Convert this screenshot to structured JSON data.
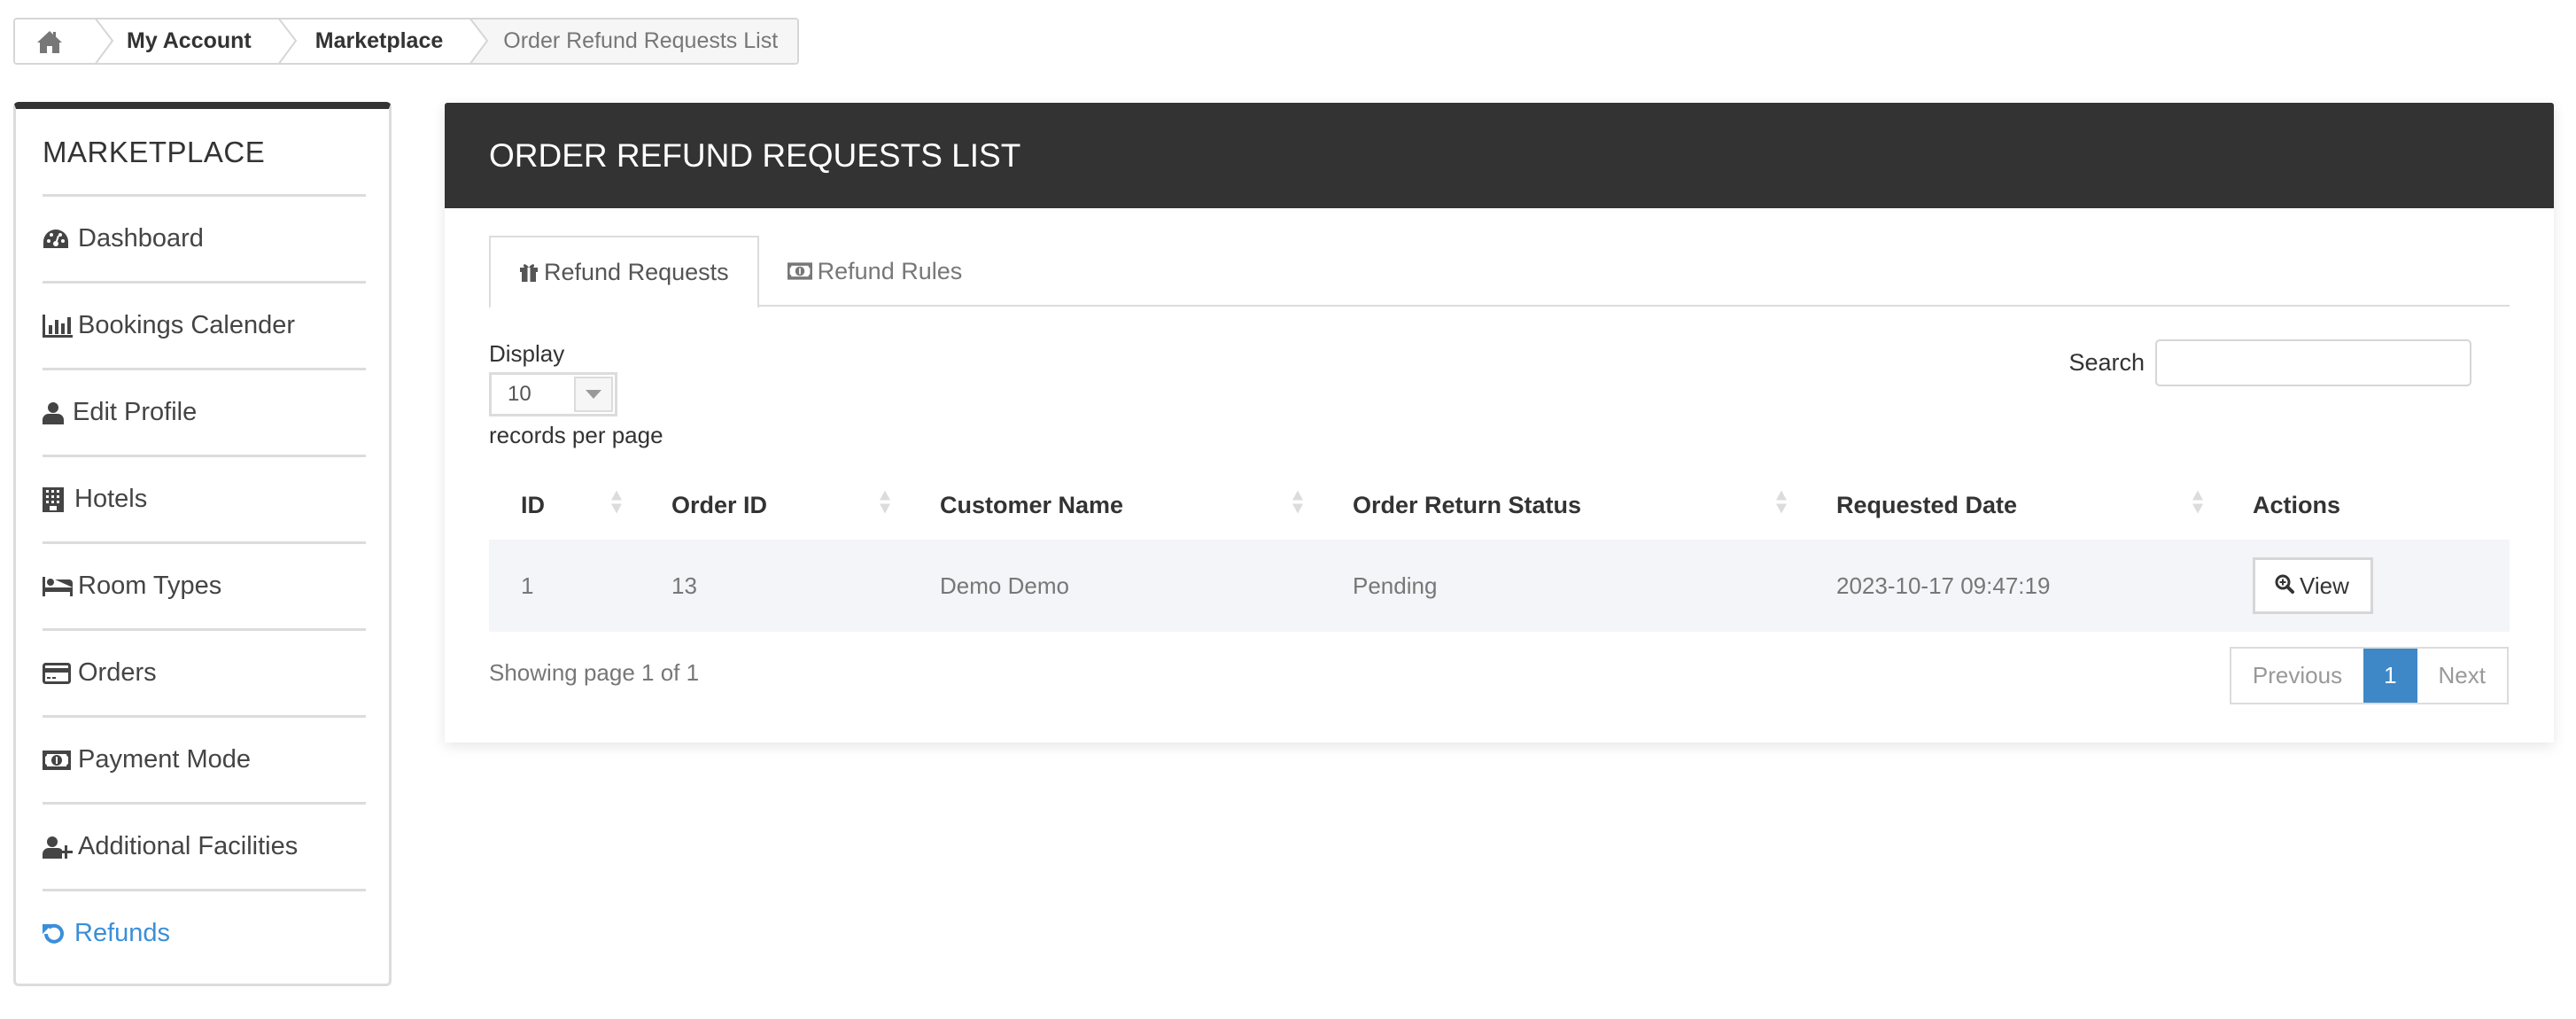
{
  "breadcrumb": {
    "home_icon": "home-icon",
    "items": [
      "My Account",
      "Marketplace",
      "Order Refund Requests List"
    ]
  },
  "sidebar": {
    "title": "MARKETPLACE",
    "items": [
      {
        "label": "Dashboard",
        "icon": "dashboard-icon"
      },
      {
        "label": "Bookings Calender",
        "icon": "bar-chart-icon"
      },
      {
        "label": "Edit Profile",
        "icon": "user-icon"
      },
      {
        "label": "Hotels",
        "icon": "building-icon"
      },
      {
        "label": "Room Types",
        "icon": "bed-icon"
      },
      {
        "label": "Orders",
        "icon": "credit-card-icon"
      },
      {
        "label": "Payment Mode",
        "icon": "money-icon"
      },
      {
        "label": "Additional Facilities",
        "icon": "user-plus-icon"
      },
      {
        "label": "Refunds",
        "icon": "undo-icon",
        "active": true
      }
    ],
    "active_color": "#3a8fd9"
  },
  "main": {
    "title": "ORDER REFUND REQUESTS LIST",
    "tabs": [
      {
        "label": "Refund Requests",
        "icon": "gift-icon",
        "active": true
      },
      {
        "label": "Refund Rules",
        "icon": "money-icon"
      }
    ],
    "display_label": "Display",
    "page_size": "10",
    "records_label": "records per page",
    "search_label": "Search",
    "search_value": "",
    "table": {
      "columns": [
        "ID",
        "Order ID",
        "Customer Name",
        "Order Return Status",
        "Requested Date",
        "Actions"
      ],
      "rows": [
        {
          "id": "1",
          "order_id": "13",
          "customer": "Demo Demo",
          "status": "Pending",
          "date": "2023-10-17 09:47:19",
          "action": "View"
        }
      ]
    },
    "showing": "Showing page 1 of 1",
    "pagination": {
      "previous": "Previous",
      "current": "1",
      "next": "Next",
      "active_color": "#3f88c8"
    }
  }
}
